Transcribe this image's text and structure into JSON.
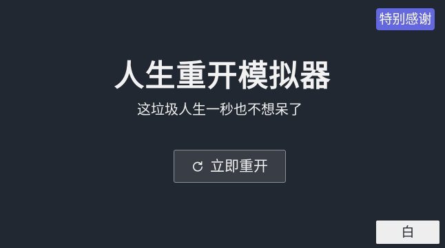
{
  "header": {
    "thanks_label": "特别感谢"
  },
  "main": {
    "title": "人生重开模拟器",
    "subtitle": "这垃圾人生一秒也不想呆了",
    "restart": {
      "icon": "refresh-icon",
      "label": "立即重开"
    }
  },
  "footer": {
    "theme_label": "白"
  },
  "colors": {
    "background": "#222831",
    "accent": "#6368e0",
    "button_bg": "#393e46",
    "text": "#eeeeee"
  }
}
